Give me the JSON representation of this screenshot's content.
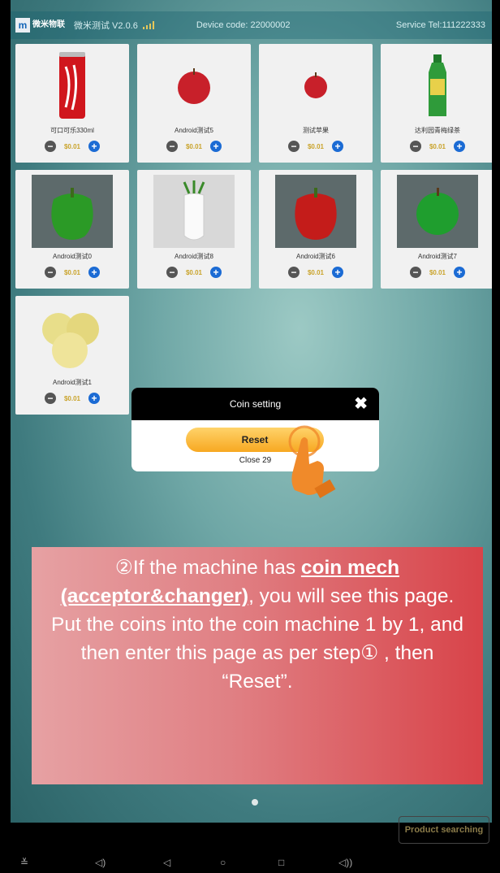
{
  "app": {
    "logo_text": "微米物联",
    "title": "微米测试 V2.0.6",
    "device_code": "Device code: 22000002",
    "service_tel": "Service Tel:111222333"
  },
  "products": [
    {
      "name": "可口可乐330ml",
      "price": "$0.01",
      "icon": "cola-can-image"
    },
    {
      "name": "Android测试5",
      "price": "$0.01",
      "icon": "apple-image"
    },
    {
      "name": "测试苹果",
      "price": "$0.01",
      "icon": "apple-image"
    },
    {
      "name": "达利园青梅绿茶",
      "price": "$0.01",
      "icon": "green-tea-bottle-image"
    },
    {
      "name": "Android测试0",
      "price": "$0.01",
      "icon": "green-pepper-image"
    },
    {
      "name": "Android测试8",
      "price": "$0.01",
      "icon": "radish-image"
    },
    {
      "name": "Android测试6",
      "price": "$0.01",
      "icon": "red-pepper-image"
    },
    {
      "name": "Android测试7",
      "price": "$0.01",
      "icon": "green-apple-image"
    },
    {
      "name": "Android测试1",
      "price": "$0.01",
      "icon": "pears-image"
    }
  ],
  "dialog": {
    "title": "Coin setting",
    "reset_label": "Reset",
    "close_text": "Close 29"
  },
  "info": {
    "line1_prefix": "②If the machine has ",
    "line1_bold": "coin mech (acceptor&changer)",
    "line1_suffix": ", you will see this page. Put the coins into the coin machine 1 by 1, and then enter this page as per step① , then “Reset”."
  },
  "search_button": "Product searching",
  "colors": {
    "plus": "#1b6bd4",
    "price": "#c9a32a",
    "reset": "#f7a821",
    "info_bg": "#d84349"
  }
}
